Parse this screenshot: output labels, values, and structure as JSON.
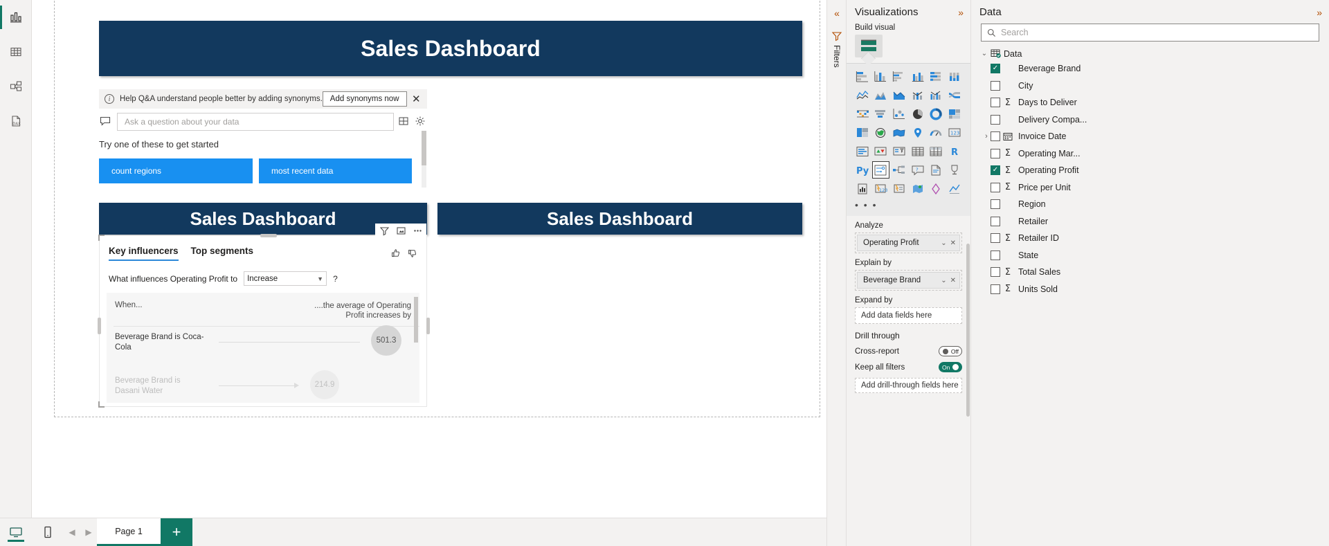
{
  "rail": {
    "items": [
      {
        "name": "report-view-icon",
        "label": "Report"
      },
      {
        "name": "table-view-icon",
        "label": "Table"
      },
      {
        "name": "model-view-icon",
        "label": "Model"
      },
      {
        "name": "dax-query-view-icon",
        "label": "DAX query view"
      }
    ]
  },
  "canvas": {
    "banner_main": "Sales Dashboard",
    "banner_left": "Sales Dashboard",
    "banner_right": "Sales Dashboard"
  },
  "qa": {
    "note": "Help Q&A understand people better by adding synonyms.",
    "add_synonyms_label": "Add synonyms now",
    "close_label": "✕",
    "placeholder": "Ask a question about your data",
    "try_label": "Try one of these to get started",
    "suggestions": [
      "count regions",
      "most recent data"
    ]
  },
  "key_influencers": {
    "tabs": [
      "Key influencers",
      "Top segments"
    ],
    "selected_tab": "Key influencers",
    "question_prefix": "What influences Operating Profit to",
    "direction": "Increase",
    "help": "?",
    "col_left": "When...",
    "col_right": "....the average of Operating Profit increases by",
    "rows": [
      {
        "label": "Beverage Brand is Coca-Cola",
        "value": "501.3",
        "dim": false
      },
      {
        "label": "Beverage Brand is Dasani Water",
        "value": "214.9",
        "dim": true
      }
    ]
  },
  "bottombar": {
    "page_tab": "Page 1",
    "add_page": "+",
    "prev": "◀",
    "next": "▶"
  },
  "filters_rail": {
    "collapse": "«",
    "label": "Filters"
  },
  "visualizations": {
    "title": "Visualizations",
    "expand": "»",
    "build_visual": "Build visual",
    "more": "• • •",
    "gallery_rows": [
      [
        "stacked-bar-chart-icon",
        "stacked-column-chart-icon",
        "clustered-bar-chart-icon",
        "clustered-column-chart-icon",
        "100-stacked-bar-chart-icon",
        "100-stacked-column-chart-icon"
      ],
      [
        "line-chart-icon",
        "area-chart-icon",
        "stacked-area-chart-icon",
        "line-stacked-column-icon",
        "line-clustered-column-icon",
        "ribbon-chart-icon"
      ],
      [
        "waterfall-chart-icon",
        "funnel-chart-icon",
        "scatter-chart-icon",
        "pie-chart-icon",
        "donut-chart-icon",
        "treemap-icon"
      ],
      [
        "map-icon",
        "filled-map-icon",
        "shape-map-icon",
        "azure-map-icon",
        "gauge-icon",
        "card-icon"
      ],
      [
        "multi-row-card-icon",
        "kpi-icon",
        "slicer-icon",
        "table-icon",
        "matrix-icon",
        "r-script-visual-icon"
      ],
      [
        "python-visual-icon",
        "key-influencers-icon",
        "decomposition-tree-icon",
        "qna-visual-icon",
        "narrative-icon",
        "metrics-icon"
      ],
      [
        "paginated-report-icon",
        "power-apps-icon",
        "power-automate-icon",
        "arcgis-maps-icon",
        "get-more-visuals-icon",
        "line-and-column-icon"
      ]
    ],
    "selected_visual": "key-influencers-icon",
    "analyze_label": "Analyze",
    "analyze_field": "Operating Profit",
    "explain_by_label": "Explain by",
    "explain_by_field": "Beverage Brand",
    "expand_by_label": "Expand by",
    "expand_by_placeholder": "Add data fields here",
    "drill_through_label": "Drill through",
    "cross_report_label": "Cross-report",
    "cross_report_state": "Off",
    "keep_all_filters_label": "Keep all filters",
    "keep_all_filters_state": "On",
    "drill_through_placeholder": "Add drill-through fields here"
  },
  "data": {
    "title": "Data",
    "expand": "»",
    "search_placeholder": "Search",
    "root": "Data",
    "fields": [
      {
        "name": "Beverage Brand",
        "checked": true,
        "measure": false,
        "date": false,
        "expandable": false
      },
      {
        "name": "City",
        "checked": false,
        "measure": false,
        "date": false,
        "expandable": false
      },
      {
        "name": "Days to Deliver",
        "checked": false,
        "measure": true,
        "date": false,
        "expandable": false
      },
      {
        "name": "Delivery Compa...",
        "checked": false,
        "measure": false,
        "date": false,
        "expandable": false
      },
      {
        "name": "Invoice Date",
        "checked": false,
        "measure": false,
        "date": true,
        "expandable": true
      },
      {
        "name": "Operating Mar...",
        "checked": false,
        "measure": true,
        "date": false,
        "expandable": false
      },
      {
        "name": "Operating Profit",
        "checked": true,
        "measure": true,
        "date": false,
        "expandable": false
      },
      {
        "name": "Price per Unit",
        "checked": false,
        "measure": true,
        "date": false,
        "expandable": false
      },
      {
        "name": "Region",
        "checked": false,
        "measure": false,
        "date": false,
        "expandable": false
      },
      {
        "name": "Retailer",
        "checked": false,
        "measure": false,
        "date": false,
        "expandable": false
      },
      {
        "name": "Retailer ID",
        "checked": false,
        "measure": true,
        "date": false,
        "expandable": false
      },
      {
        "name": "State",
        "checked": false,
        "measure": false,
        "date": false,
        "expandable": false
      },
      {
        "name": "Total Sales",
        "checked": false,
        "measure": true,
        "date": false,
        "expandable": false
      },
      {
        "name": "Units Sold",
        "checked": false,
        "measure": true,
        "date": false,
        "expandable": false
      }
    ]
  },
  "colors": {
    "banner": "#12395e",
    "chip": "#1890f1",
    "accent_teal": "#117865",
    "accent_orange": "#b24d02",
    "tab_underline": "#2b88d8"
  }
}
